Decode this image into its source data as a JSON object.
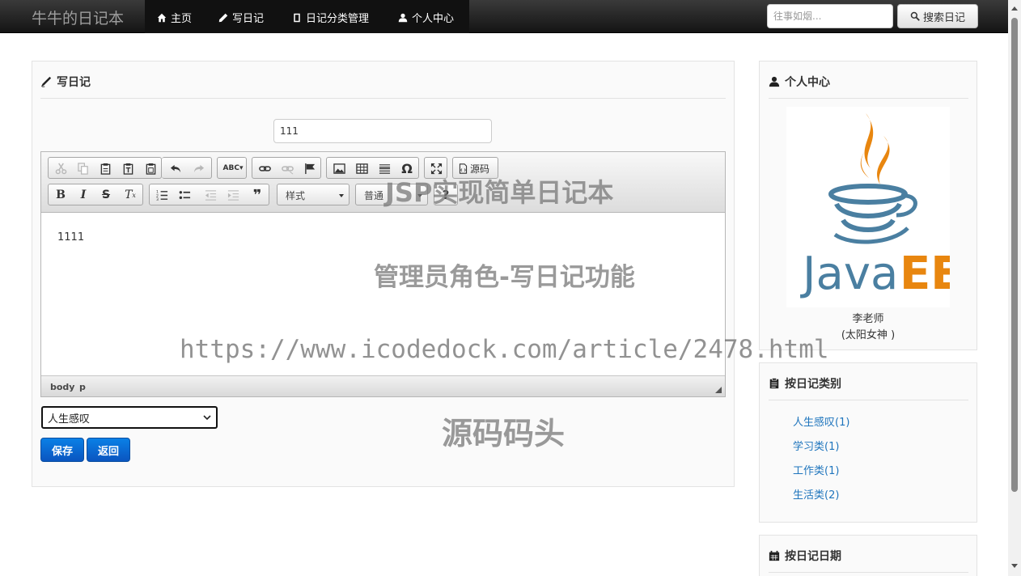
{
  "navbar": {
    "brand": "牛牛的日记本",
    "items": [
      {
        "label": "主页",
        "icon": "home-icon"
      },
      {
        "label": "写日记",
        "icon": "pencil-icon"
      },
      {
        "label": "日记分类管理",
        "icon": "book-icon"
      },
      {
        "label": "个人中心",
        "icon": "user-icon"
      }
    ],
    "search_placeholder": "往事如烟...",
    "search_button": "搜索日记"
  },
  "write_panel": {
    "title": "写日记",
    "title_value": "111",
    "editor": {
      "content": "1111",
      "source_button": "源码",
      "style_combo": "样式",
      "format_combo": "普通",
      "help": "?",
      "path": [
        "body",
        "p"
      ]
    },
    "category_selected": "人生感叹",
    "save_button": "保存",
    "back_button": "返回"
  },
  "sidebar": {
    "profile_title": "个人中心",
    "avatar_alt": "Java EE",
    "user_name": "李老师",
    "user_motto": "(太阳女神 )",
    "category_title": "按日记类别",
    "categories": [
      "人生感叹(1)",
      "学习类(1)",
      "工作类(1)",
      "生活类(2)"
    ],
    "date_title": "按日记日期"
  },
  "watermarks": {
    "line1": "JSP实现简单日记本",
    "line2": "管理员角色-写日记功能",
    "line3": "https://www.icodedock.com/article/2478.html",
    "line4": "源码码头"
  },
  "colors": {
    "navbar_bg": "#1b1b1b",
    "primary": "#0a6fd8",
    "link": "#1f75bd",
    "java_orange": "#e8860f",
    "java_blue": "#4a7fa1"
  }
}
